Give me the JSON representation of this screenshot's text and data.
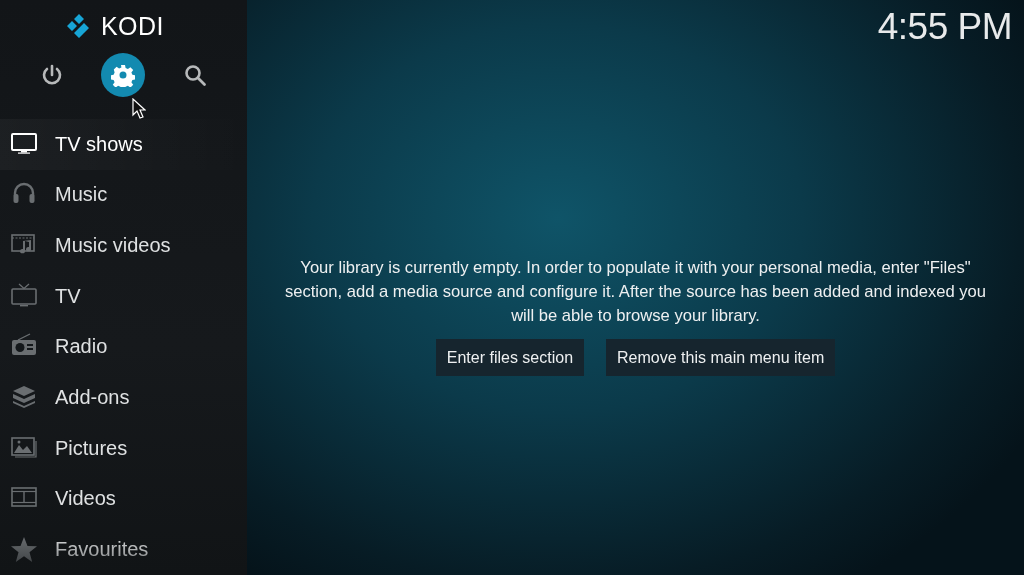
{
  "logo": {
    "text": "KODI"
  },
  "top_buttons": [
    {
      "kind": "power",
      "selected": false
    },
    {
      "kind": "settings",
      "selected": true
    },
    {
      "kind": "search",
      "selected": false
    }
  ],
  "menu": [
    {
      "label": "TV shows",
      "selected": true
    },
    {
      "label": "Music",
      "selected": false
    },
    {
      "label": "Music videos",
      "selected": false
    },
    {
      "label": "TV",
      "selected": false
    },
    {
      "label": "Radio",
      "selected": false
    },
    {
      "label": "Add-ons",
      "selected": false
    },
    {
      "label": "Pictures",
      "selected": false
    },
    {
      "label": "Videos",
      "selected": false
    },
    {
      "label": "Favourites",
      "selected": false
    }
  ],
  "clock": "4:55 PM",
  "message": "Your library is currently empty. In order to populate it with your personal media, enter \"Files\" section, add a media source and configure it. After the source has been added and indexed you will be able to browse your library.",
  "buttons": [
    "Enter files section",
    "Remove this main menu item"
  ]
}
